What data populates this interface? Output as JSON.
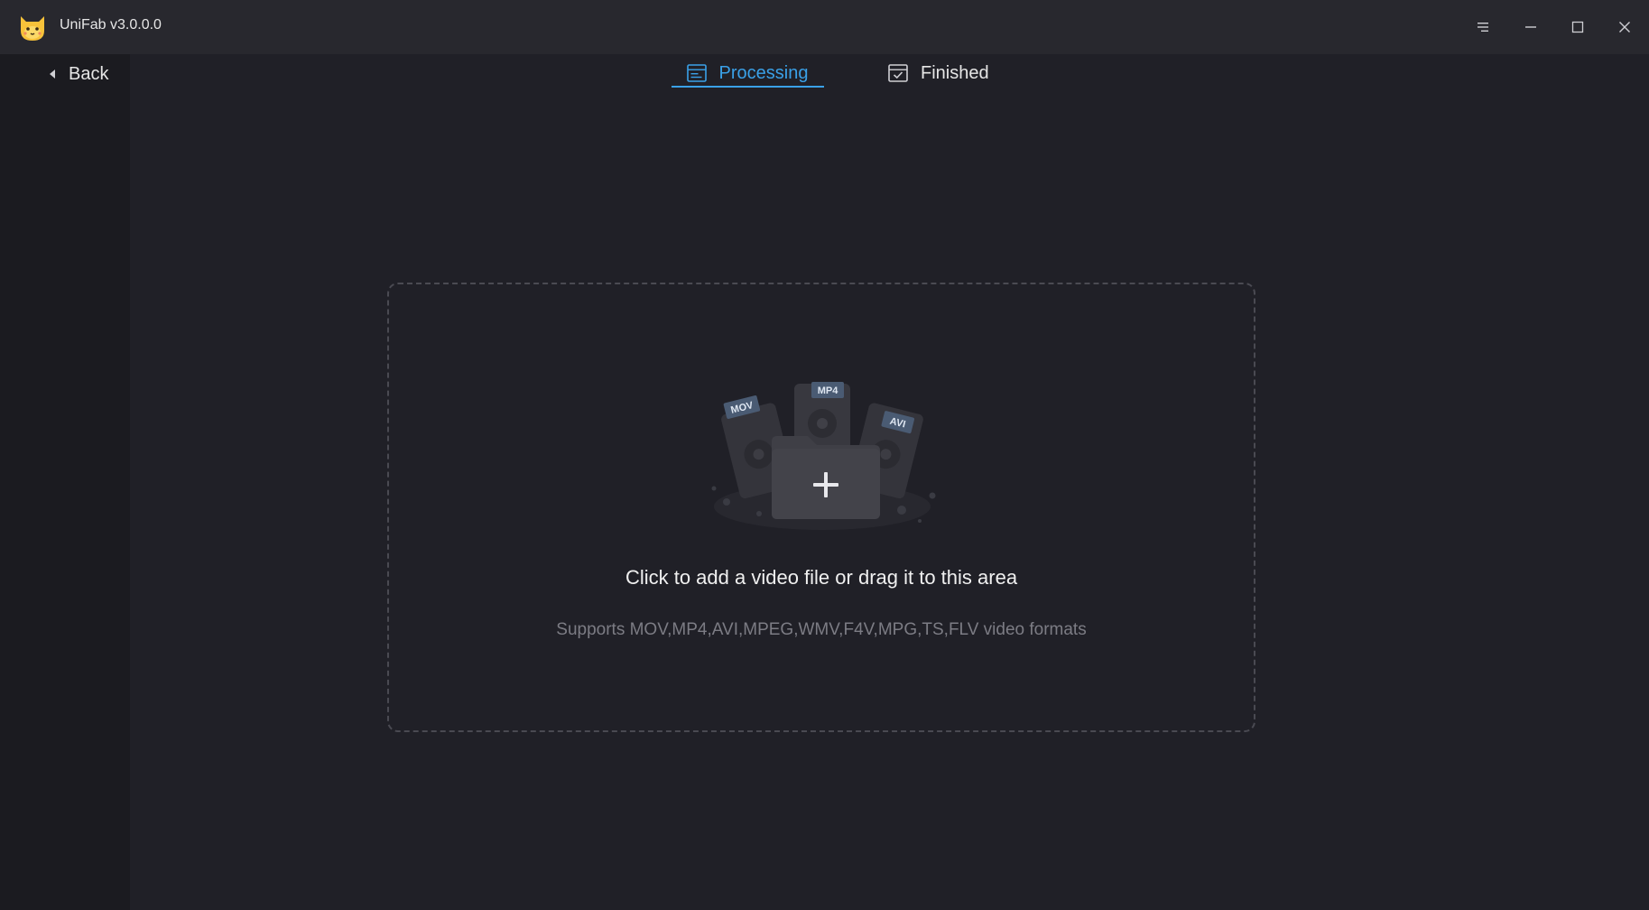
{
  "app": {
    "title": "UniFab v3.0.0.0"
  },
  "nav": {
    "back_label": "Back",
    "tabs": [
      {
        "label": "Processing",
        "active": true
      },
      {
        "label": "Finished",
        "active": false
      }
    ]
  },
  "dropzone": {
    "title": "Click to add a video file or drag it to this area",
    "subtitle": "Supports MOV,MP4,AVI,MPEG,WMV,F4V,MPG,TS,FLV video formats",
    "badges": [
      "MOV",
      "MP4",
      "AVI"
    ]
  },
  "colors": {
    "accent": "#3aa1e8",
    "titlebar": "#28282e",
    "background": "#202027",
    "text": "#e6e6e6",
    "muted_text": "#7c7c84"
  },
  "icons": {
    "window_menu": "menu-icon",
    "minimize": "minimize-icon",
    "maximize": "maximize-icon",
    "close": "close-icon"
  }
}
